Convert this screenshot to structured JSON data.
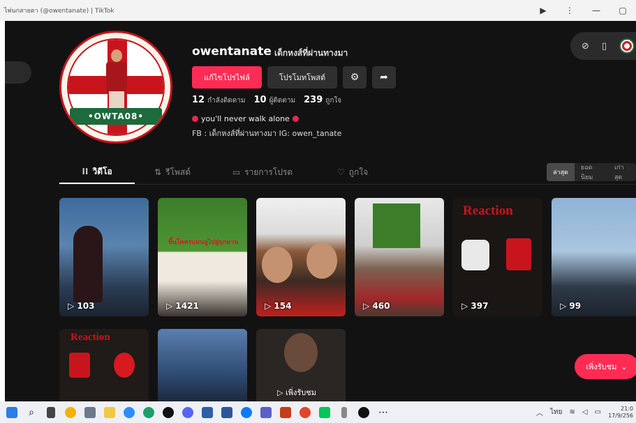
{
  "window": {
    "title": "ไพ่นกสายตา (@owentanate) | TikTok",
    "controls": [
      "▶",
      "⋮",
      "—",
      "▢"
    ]
  },
  "profile": {
    "username": "owentanate",
    "nickname": "เด็กหงส์ที่ผ่านทางมา",
    "avatar_banner": "OWTA08",
    "edit_button": "แก้ไขโปรไฟล์",
    "promote_button": "โปรโมทโพสต์",
    "stats": [
      {
        "value": "12",
        "label": "กำลังติดตาม"
      },
      {
        "value": "10",
        "label": "ผู้ติดตาม"
      },
      {
        "value": "239",
        "label": "ถูกใจ"
      }
    ],
    "bio_line1": "you'll never walk alone",
    "bio_line2": "FB : เด็กหงส์ที่ผ่านทางมา IG: owen_tanate"
  },
  "tabs": [
    {
      "label": "วิดีโอ",
      "icon": "grid-icon",
      "active": true
    },
    {
      "label": "รีโพสต์",
      "icon": "repost-icon",
      "active": false
    },
    {
      "label": "รายการโปรด",
      "icon": "bookmark-icon",
      "active": false
    },
    {
      "label": "ถูกใจ",
      "icon": "heart-icon",
      "active": false
    }
  ],
  "sort_options": [
    {
      "label": "ล่าสุด",
      "active": true
    },
    {
      "label": "ยอดนิยม",
      "active": false
    },
    {
      "label": "เก่าสุด",
      "active": false
    }
  ],
  "videos": [
    {
      "views": "103"
    },
    {
      "views": "1421",
      "overlay": "ขึ้นโคตรแมนยูไปสู่ฤกษาน"
    },
    {
      "views": "154"
    },
    {
      "views": "460"
    },
    {
      "views": "397",
      "overlay": "Reaction"
    },
    {
      "views": "99"
    }
  ],
  "videos_row2": [
    {
      "overlay": "Reaction"
    },
    {
      "overlay": ""
    },
    {
      "overlay": "เพิ่งรับชม"
    }
  ],
  "more_button": "เพิ่งรับชม",
  "tray": {
    "lang": "ไทย",
    "time": "21:0",
    "date": "17/9/256"
  },
  "colors": {
    "brand_pink": "#fe2c55",
    "background": "#121212",
    "liverpool_red": "#c8151d",
    "banner_green": "#1d6a3c"
  }
}
